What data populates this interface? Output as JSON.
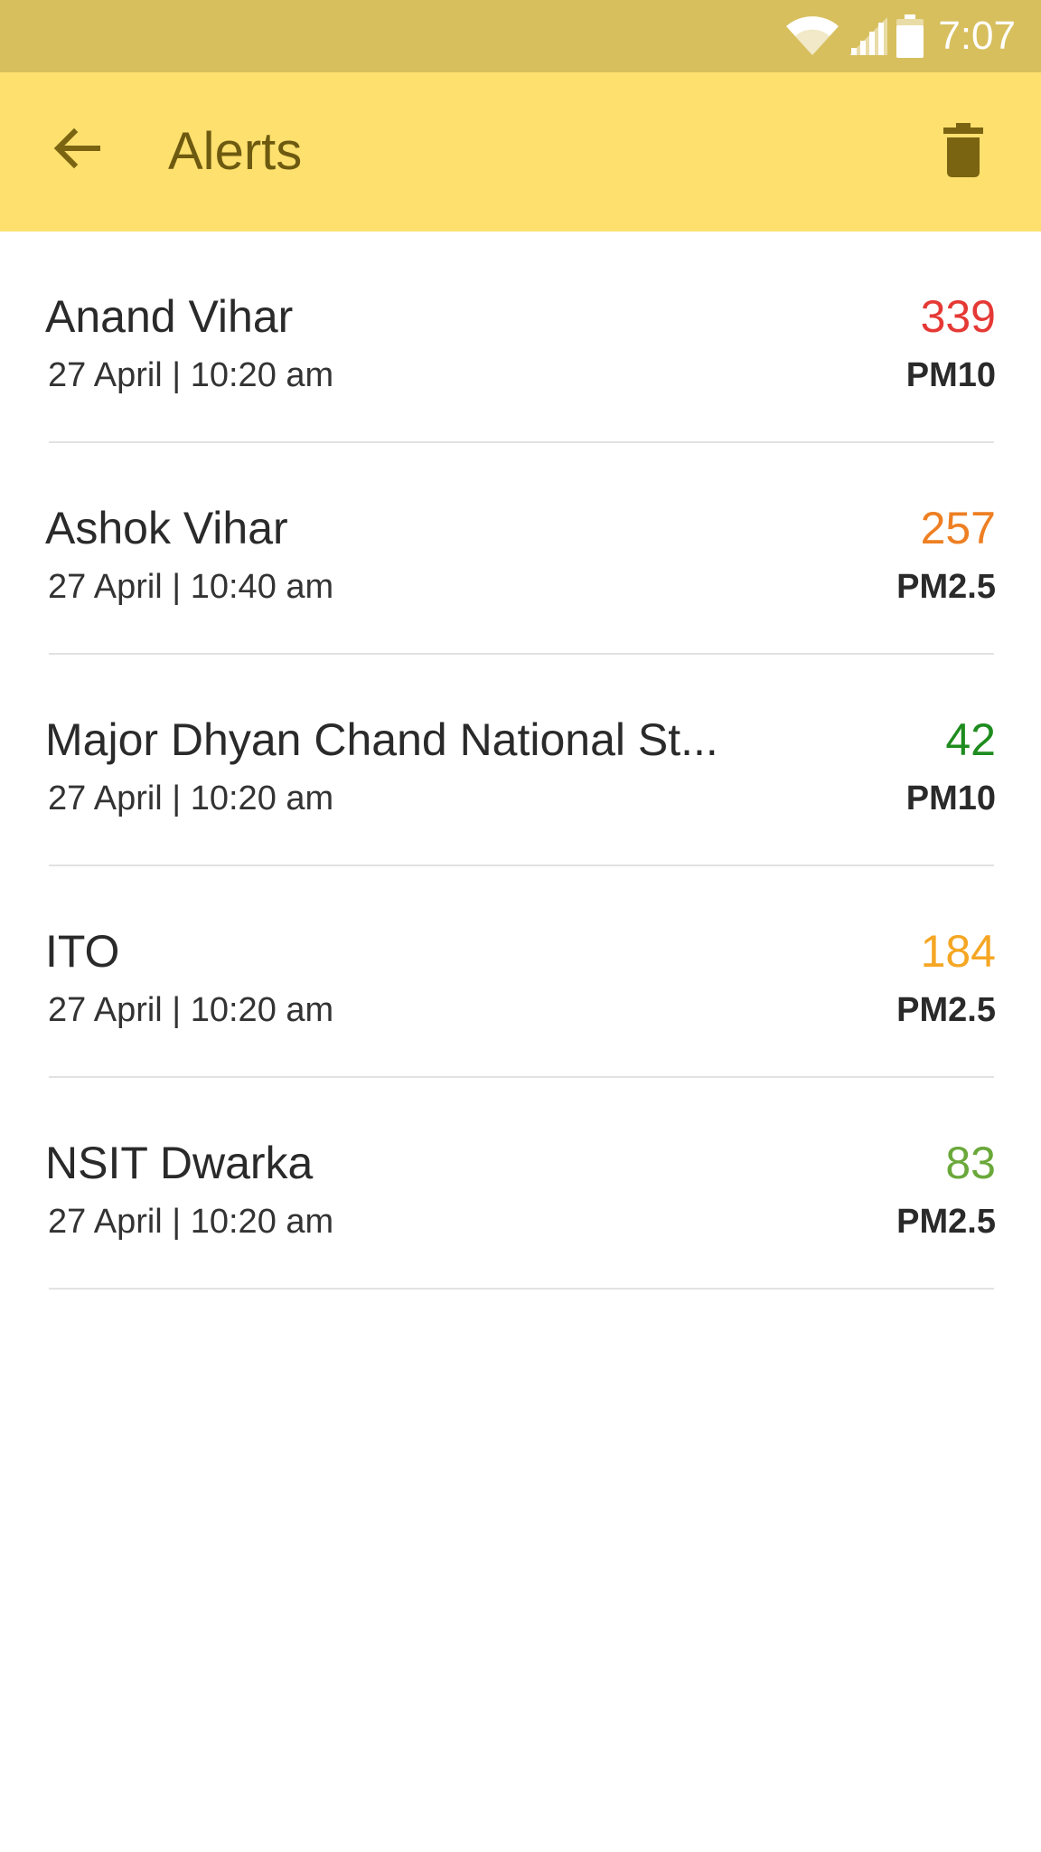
{
  "status_bar": {
    "time": "7:07",
    "icons": [
      "wifi-icon",
      "signal-icon",
      "battery-icon"
    ]
  },
  "app_bar": {
    "title": "Alerts",
    "back_icon": "arrow-back-icon",
    "delete_icon": "trash-icon",
    "background": "#fde06e",
    "status_background": "#d7bf5e"
  },
  "alerts": [
    {
      "station": "Anand Vihar",
      "time": "27 April | 10:20 am",
      "value": "339",
      "pollutant": "PM10",
      "color": "#e53935"
    },
    {
      "station": "Ashok Vihar",
      "time": "27 April | 10:40 am",
      "value": "257",
      "pollutant": "PM2.5",
      "color": "#ee7f22"
    },
    {
      "station": "Major Dhyan Chand National St...",
      "time": "27 April | 10:20 am",
      "value": "42",
      "pollutant": "PM10",
      "color": "#1e8c1e"
    },
    {
      "station": "ITO",
      "time": "27 April | 10:20 am",
      "value": "184",
      "pollutant": "PM2.5",
      "color": "#f5a623"
    },
    {
      "station": "NSIT Dwarka",
      "time": "27 April | 10:20 am",
      "value": "83",
      "pollutant": "PM2.5",
      "color": "#6aa83a"
    }
  ]
}
